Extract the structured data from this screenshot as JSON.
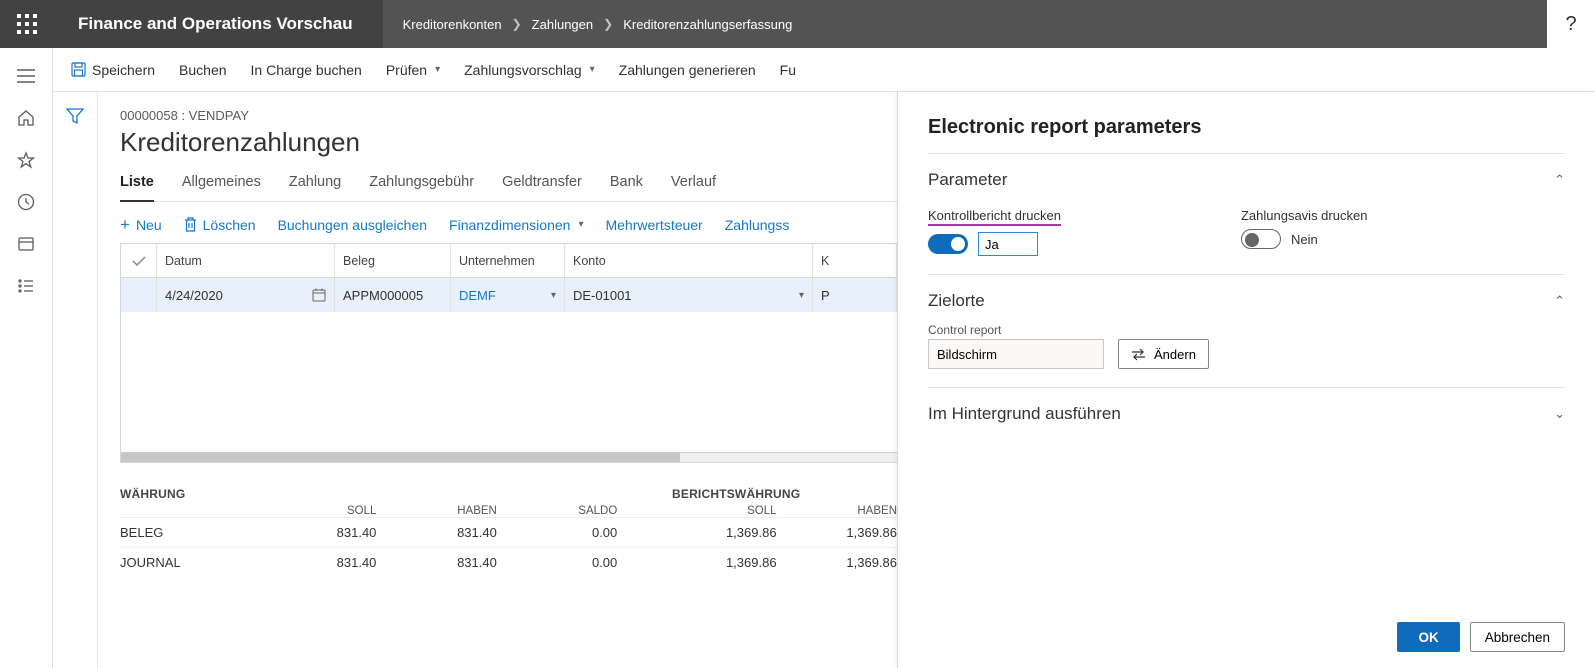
{
  "appbar": {
    "title": "Finance and Operations Vorschau",
    "breadcrumb": [
      "Kreditorenkonten",
      "Zahlungen",
      "Kreditorenzahlungserfassung"
    ]
  },
  "actionbar": {
    "save": "Speichern",
    "post": "Buchen",
    "post_batch": "In Charge buchen",
    "validate": "Prüfen",
    "proposal": "Zahlungsvorschlag",
    "generate": "Zahlungen generieren",
    "funct": "Fu"
  },
  "page": {
    "subheader": "00000058 : VENDPAY",
    "title": "Kreditorenzahlungen",
    "tabs": [
      "Liste",
      "Allgemeines",
      "Zahlung",
      "Zahlungsgebühr",
      "Geldtransfer",
      "Bank",
      "Verlauf"
    ]
  },
  "listbar": {
    "new": "Neu",
    "delete": "Löschen",
    "settle": "Buchungen ausgleichen",
    "findim": "Finanzdimensionen",
    "vat": "Mehrwertsteuer",
    "paystatus": "Zahlungss"
  },
  "grid": {
    "headers": {
      "datum": "Datum",
      "beleg": "Beleg",
      "unternehmen": "Unternehmen",
      "konto": "Konto",
      "kr": "K"
    },
    "row": {
      "datum": "4/24/2020",
      "beleg": "APPM000005",
      "unternehmen": "DEMF",
      "konto": "DE-01001",
      "kr": "P"
    }
  },
  "totals": {
    "group1": "WÄHRUNG",
    "group2": "BERICHTSWÄHRUNG",
    "cols": {
      "soll": "SOLL",
      "haben": "HABEN",
      "saldo": "SALDO"
    },
    "rows": [
      {
        "label": "BELEG",
        "soll": "831.40",
        "haben": "831.40",
        "saldo": "0.00",
        "rsoll": "1,369.86",
        "rhaben": "1,369.86"
      },
      {
        "label": "JOURNAL",
        "soll": "831.40",
        "haben": "831.40",
        "saldo": "0.00",
        "rsoll": "1,369.86",
        "rhaben": "1,369.86"
      }
    ]
  },
  "pane": {
    "title": "Electronic report parameters",
    "sections": {
      "parameter": "Parameter",
      "destinations": "Zielorte",
      "background": "Im Hintergrund ausführen"
    },
    "param": {
      "print_control_label": "Kontrollbericht drucken",
      "print_control_value": "Ja",
      "print_advice_label": "Zahlungsavis drucken",
      "print_advice_value": "Nein"
    },
    "dest": {
      "control_report_label": "Control report",
      "control_report_value": "Bildschirm",
      "change": "Ändern"
    },
    "ok": "OK",
    "cancel": "Abbrechen"
  }
}
